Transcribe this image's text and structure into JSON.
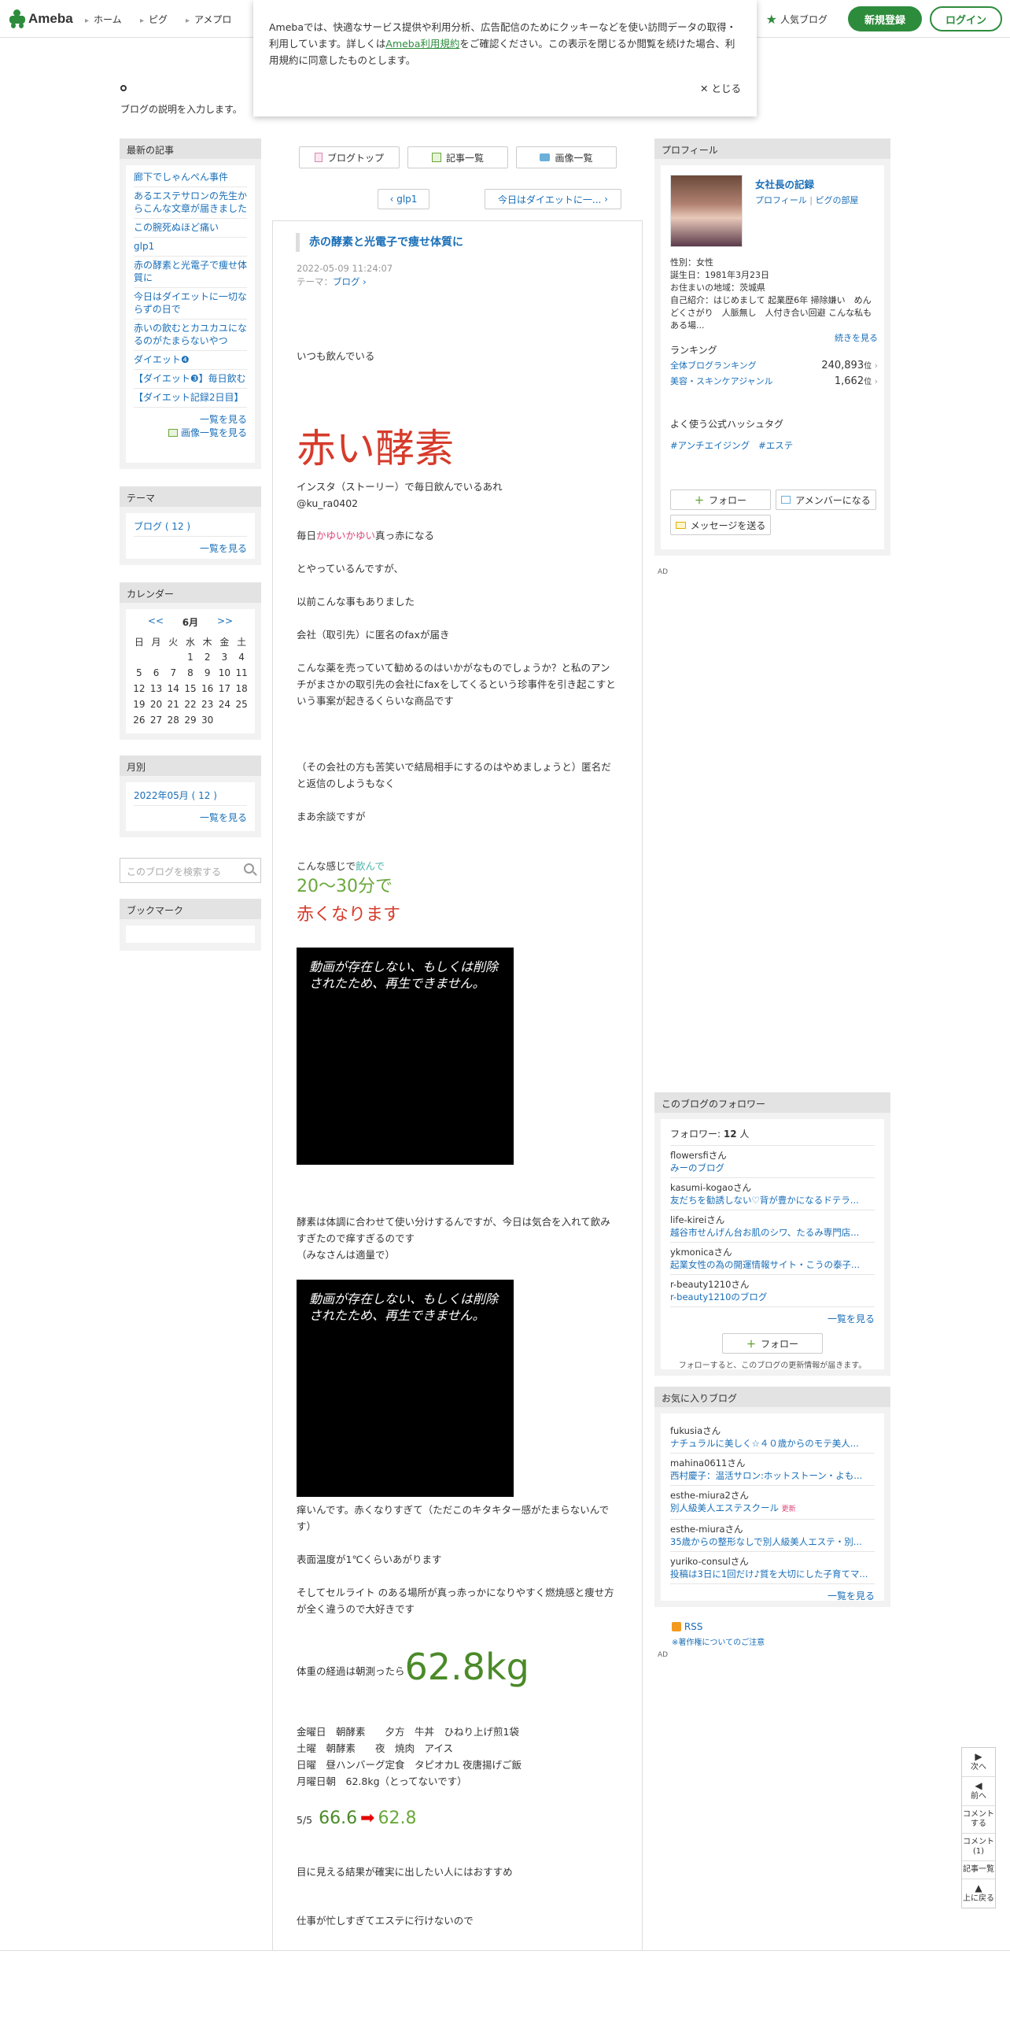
{
  "topbar": {
    "logo": "Ameba",
    "nav": [
      "ホーム",
      "ピグ",
      "アメプロ"
    ],
    "popular": "人気ブログ",
    "register": "新規登録",
    "login": "ログイン"
  },
  "cookie": {
    "text_pre": "Amebaでは、快適なサービス提供や利用分析、広告配信のためにクッキーなどを使い訪問データの取得・利用しています。詳しくは",
    "terms": "Ameba利用規約",
    "text_post": "をご確認ください。この表示を閉じるか閲覧を続けた場合、利用規約に同意したものとします。",
    "close": "とじる"
  },
  "header": {
    "description": "ブログの説明を入力します。"
  },
  "left": {
    "recent_title": "最新の記事",
    "recent": [
      "廊下でしゃんぺん事件",
      "あるエステサロンの先生からこんな文章が届きました",
      "この腕死ぬほど痛い",
      "glp1",
      "赤の酵素と光電子で痩せ体質に",
      "今日はダイエットに一切ならずの日で",
      "赤いの飲むとカユカユになるのがたまらないやつ",
      "ダイエット❹",
      "【ダイエット❸】毎日飲む",
      "【ダイエット記録2日目】"
    ],
    "recent_more": "一覧を見る",
    "recent_images": "画像一覧を見る",
    "theme_title": "テーマ",
    "theme_item": "ブログ ( 12 )",
    "theme_more": "一覧を見る",
    "calendar_title": "カレンダー",
    "cal_prev": "<<",
    "cal_month": "6月",
    "cal_next": ">>",
    "cal_days": [
      "日",
      "月",
      "火",
      "水",
      "木",
      "金",
      "土"
    ],
    "cal_rows": [
      [
        "",
        "",
        "",
        "1",
        "2",
        "3",
        "4"
      ],
      [
        "5",
        "6",
        "7",
        "8",
        "9",
        "10",
        "11"
      ],
      [
        "12",
        "13",
        "14",
        "15",
        "16",
        "17",
        "18"
      ],
      [
        "19",
        "20",
        "21",
        "22",
        "23",
        "24",
        "25"
      ],
      [
        "26",
        "27",
        "28",
        "29",
        "30",
        "",
        ""
      ]
    ],
    "monthly_title": "月別",
    "monthly_item": "2022年05月 ( 12 )",
    "monthly_more": "一覧を見る",
    "search_placeholder": "このブログを検索する",
    "bookmark_title": "ブックマーク"
  },
  "center": {
    "btn_top": "ブログトップ",
    "btn_list": "記事一覧",
    "btn_images": "画像一覧",
    "prev": "glp1",
    "next": "今日はダイエットに一...",
    "title": "赤の酵素と光電子で痩せ体質に",
    "date": "2022-05-09 11:24:07",
    "theme_label": "テーマ：",
    "theme": "ブログ",
    "p1": "いつも飲んでいる",
    "big1": "赤い酵素",
    "p2a": "インスタ（ストーリー）で毎日飲んでいるあれ",
    "p2b": "@ku_ra0402",
    "p3a": "毎日",
    "p3b": "かゆいかゆい",
    "p3c": "真っ赤になる",
    "p4": "とやっているんですが、",
    "p5": "以前こんな事もありました",
    "p6": "会社（取引先）に匿名のfaxが届き",
    "p7": "こんな薬を売っていて勧めるのはいかがなものでしょうか？と私のアンチがまさかの取引先の会社にfaxをしてくるという珍事件を引き起こすという事案が起きるくらいな商品です",
    "p8": "（その会社の方も苦笑いで結局相手にするのはやめましょうと）匿名だと返信のしようもなく",
    "p9": "まあ余談ですが",
    "p10a": "こんな感じで",
    "p10b": "飲んで",
    "p11": "20〜30分で",
    "p12": "赤くなります",
    "video_msg": "動画が存在しない、もしくは削除されたため、再生できません。",
    "p13": "酵素は体調に合わせて使い分けするんですが、今日は気合を入れて飲みすぎたので痒すぎるのです\n（みなさんは適量で）",
    "p14": "痒いんです。赤くなりすぎて（ただこのキタキター感がたまらないんです）",
    "p15": "表面温度が1℃くらいあがります",
    "p16": "そしてセルライト のある場所が真っ赤っかになりやすく燃焼感と痩せ方が全く違うので大好きです",
    "p17a": "体重の経過は朝測ったら",
    "p17b": "62.8kg",
    "p18": "金曜日　朝酵素　　夕方　牛丼　ひねり上げ煎1袋\n土曜　朝酵素　　夜　焼肉　アイス\n日曜　昼ハンバーグ定食　タピオカL  夜唐揚げご飯\n月曜日朝　62.8kg（とってないです）",
    "p19a": "5/5",
    "p19b": "66.6",
    "p19c": "62.8",
    "p20": "目に見える結果が確実に出したい人にはおすすめ",
    "p21": "仕事が忙しすぎてエステに行けないので"
  },
  "right": {
    "profile_title": "プロフィール",
    "name": "女社長の記録",
    "links_a": "プロフィール",
    "links_b": "ピグの部屋",
    "gender": "性別：女性",
    "birthday": "誕生日：1981年3月23日",
    "area": "お住まいの地域：茨城県",
    "intro": "自己紹介：はじめまして 起業歴6年 掃除嫌い　めんどくさがり　人脈無し　人付き合い回避 こんな私もある場...",
    "read_more": "続きを見る",
    "ranking_title": "ランキング",
    "rank1_label": "全体ブログランキング",
    "rank1_value": "240,893",
    "rank2_label": "美容・スキンケアジャンル",
    "rank2_value": "1,662",
    "rank_unit": "位",
    "hashtag_title": "よく使う公式ハッシュタグ",
    "hashtag1": "#アンチエイジング",
    "hashtag2": "#エステ",
    "follow": "フォロー",
    "amember": "アメンバーになる",
    "message": "メッセージを送る",
    "ad": "AD",
    "followers_title": "このブログのフォロワー",
    "followers_label": "フォロワー:",
    "followers_count": "12",
    "followers_unit": "人",
    "followers": [
      {
        "name": "flowersfiさん",
        "blog": "みーのブログ"
      },
      {
        "name": "kasumi-kogaoさん",
        "blog": "友だちを勧誘しない♡背が豊かになるドテラ..."
      },
      {
        "name": "life-kireiさん",
        "blog": "越谷市せんげん台お肌のシワ、たるみ専門店..."
      },
      {
        "name": "ykmonicaさん",
        "blog": "起業女性の為の開運情報サイト・こうの泰子..."
      },
      {
        "name": "r-beauty1210さん",
        "blog": "r-beauty1210のブログ"
      }
    ],
    "followers_more": "一覧を見る",
    "follow_btn": "フォロー",
    "follow_note": "フォローすると、このブログの更新情報が届きます。",
    "fav_title": "お気に入りブログ",
    "favs": [
      {
        "name": "fukusiaさん",
        "blog": "ナチュラルに美しく☆４０歳からのモテ美人...",
        "badge": ""
      },
      {
        "name": "mahina0611さん",
        "blog": "西村慶子：温活サロン:ホットストーン・よも...",
        "badge": ""
      },
      {
        "name": "esthe-miura2さん",
        "blog": "別人級美人エステスクール",
        "badge": "更新"
      },
      {
        "name": "esthe-miuraさん",
        "blog": "35歳からの整形なしで別人級美人エステ・別...",
        "badge": ""
      },
      {
        "name": "yuriko-consulさん",
        "blog": "投稿は3日に1回だけ♪質を大切にした子育てマ...",
        "badge": ""
      }
    ],
    "fav_more": "一覧を見る",
    "rss": "RSS",
    "copyright": "※著作権についてのご注意"
  },
  "floatnav": {
    "next": "次へ",
    "prev": "前へ",
    "comment_write": "コメントする",
    "comment_count": "コメント(1)",
    "list": "記事一覧",
    "top": "上に戻る"
  },
  "colors": {
    "accent": "#2d8c3c",
    "link": "#1a6fb8",
    "red": "#d63b2b"
  }
}
